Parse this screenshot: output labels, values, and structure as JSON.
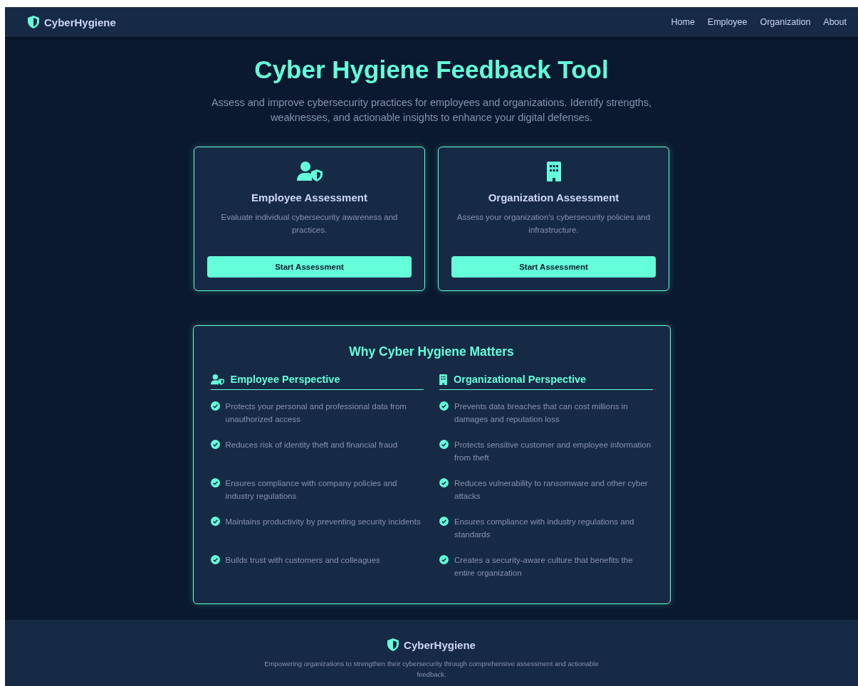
{
  "navbar": {
    "brand": "CyberHygiene",
    "links": [
      "Home",
      "Employee",
      "Organization",
      "About"
    ]
  },
  "hero": {
    "title": "Cyber Hygiene Feedback Tool",
    "subtitle": "Assess and improve cybersecurity practices for employees and organizations. Identify strengths, weaknesses, and actionable insights to enhance your digital defenses."
  },
  "cards": [
    {
      "kind": "employee",
      "title": "Employee Assessment",
      "description": "Evaluate individual cybersecurity awareness and practices.",
      "button": "Start Assessment"
    },
    {
      "kind": "organization",
      "title": "Organization Assessment",
      "description": "Assess your organization's cybersecurity policies and infrastructure.",
      "button": "Start Assessment"
    }
  ],
  "why": {
    "title": "Why Cyber Hygiene Matters",
    "columns": [
      {
        "kind": "employee",
        "heading": "Employee Perspective",
        "items": [
          "Protects your personal and professional data from unauthorized access",
          "Reduces risk of identity theft and financial fraud",
          "Ensures compliance with company policies and industry regulations",
          "Maintains productivity by preventing security incidents",
          "Builds trust with customers and colleagues"
        ]
      },
      {
        "kind": "organization",
        "heading": "Organizational Perspective",
        "items": [
          "Prevents data breaches that can cost millions in damages and reputation loss",
          "Protects sensitive customer and employee information from theft",
          "Reduces vulnerability to ransomware and other cyber attacks",
          "Ensures compliance with industry regulations and standards",
          "Creates a security-aware culture that benefits the entire organization"
        ]
      }
    ]
  },
  "footer": {
    "brand": "CyberHygiene",
    "text": "Empowering organizations to strengthen their cybersecurity through comprehensive assessment and actionable feedback."
  }
}
